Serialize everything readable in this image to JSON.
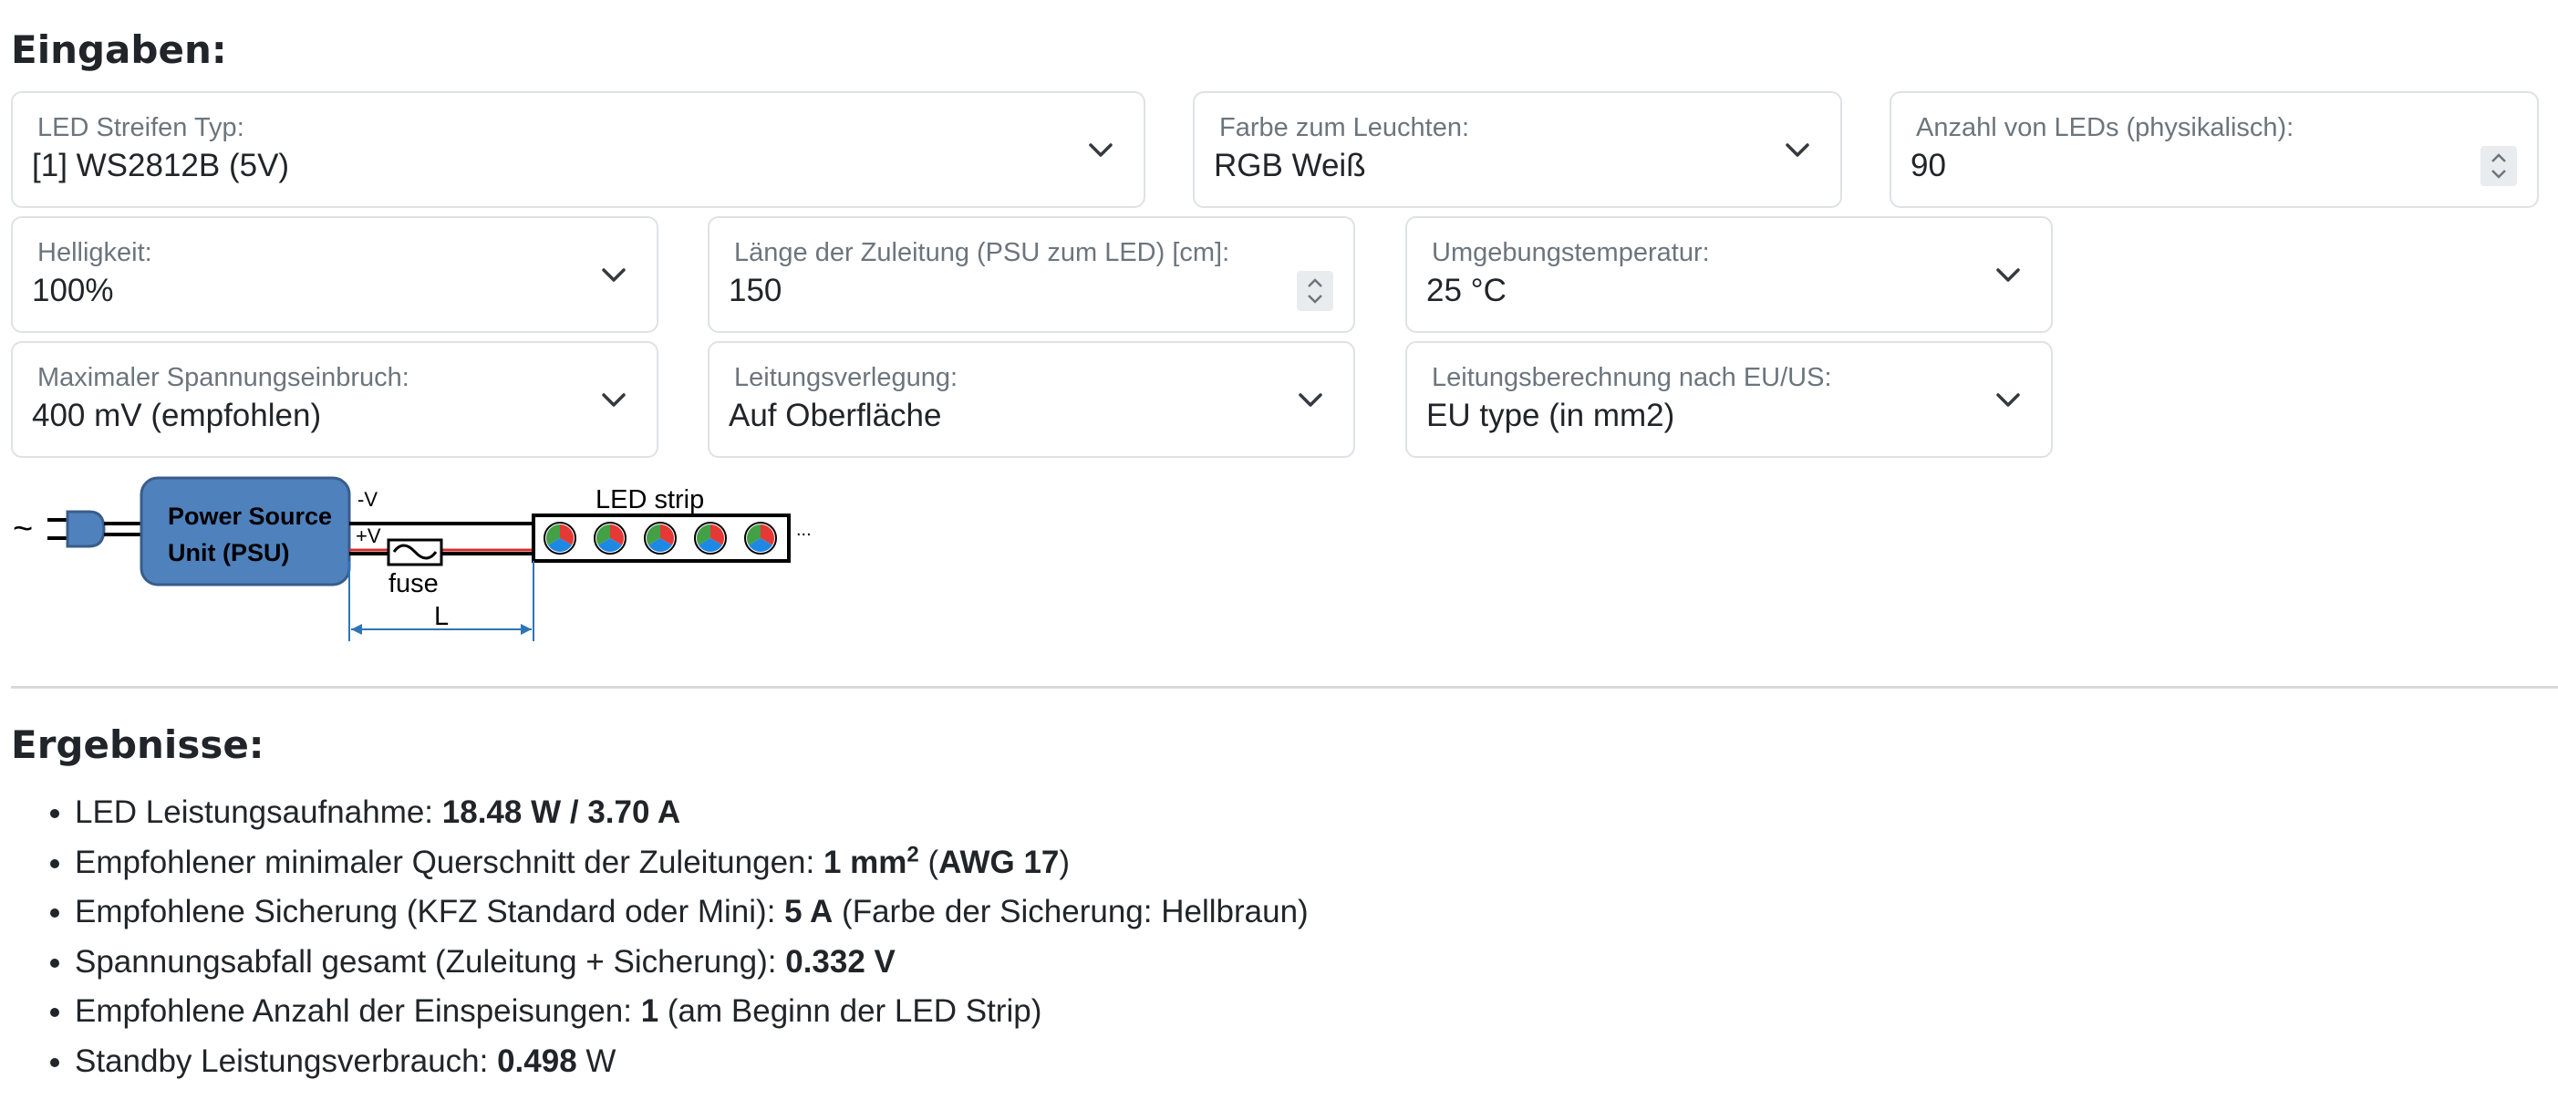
{
  "inputs": {
    "heading": "Eingaben:",
    "led_type": {
      "label": "LED Streifen Typ:",
      "value": "[1] WS2812B (5V)"
    },
    "color": {
      "label": "Farbe zum Leuchten:",
      "value": "RGB Weiß"
    },
    "led_count": {
      "label": "Anzahl von LEDs (physikalisch):",
      "value": "90"
    },
    "brightness": {
      "label": "Helligkeit:",
      "value": "100%"
    },
    "lead_length": {
      "label": "Länge der Zuleitung (PSU zum LED) [cm]:",
      "value": "150"
    },
    "ambient_temp": {
      "label": "Umgebungstemperatur:",
      "value": "25 °C"
    },
    "max_voltage_drop": {
      "label": "Maximaler Spannungseinbruch:",
      "value": "400 mV (empfohlen)"
    },
    "wiring": {
      "label": "Leitungsverlegung:",
      "value": "Auf Oberfläche"
    },
    "cable_standard": {
      "label": "Leitungsberechnung nach EU/US:",
      "value": "EU type (in mm2)"
    }
  },
  "diagram": {
    "ac_symbol": "~",
    "psu_line1": "Power Source",
    "psu_line2": "Unit (PSU)",
    "minus_v": "-V",
    "plus_v": "+V",
    "fuse_label": "fuse",
    "strip_label": "LED strip",
    "length_label": "L",
    "ellipsis": "..."
  },
  "results": {
    "heading": "Ergebnisse:",
    "power": {
      "label": "LED Leistungsaufnahme: ",
      "watts": "18.48 W",
      "sep": " / ",
      "amps": "3.70 A"
    },
    "cross_section": {
      "label": "Empfohlener minimaler Querschnitt der Zuleitungen: ",
      "value": "1 mm",
      "sup": "2",
      "open": " (",
      "awg": "AWG 17",
      "close": ")"
    },
    "fuse": {
      "label": "Empfohlene Sicherung (KFZ Standard oder Mini): ",
      "value": "5 A",
      "note": " (Farbe der Sicherung: Hellbraun)"
    },
    "voltage_drop": {
      "label": "Spannungsabfall gesamt (Zuleitung + Sicherung): ",
      "value": "0.332 V"
    },
    "feed_points": {
      "label": "Empfohlene Anzahl der Einspeisungen: ",
      "value": "1",
      "note": " (am Beginn der LED Strip)"
    },
    "standby": {
      "label": "Standby Leistungsverbrauch: ",
      "value": "0.498",
      "unit": " W"
    }
  },
  "colors": {
    "psu_fill": "#4f81bd",
    "psu_stroke": "#385d8a",
    "plus_wire": "#d32f2f",
    "dimension_line": "#2e75b6",
    "led_red": "#e53935",
    "led_green": "#43a047",
    "led_blue": "#1e88e5"
  },
  "icons": {
    "select": "chevron-down-icon",
    "number": "spinner-icon",
    "plug": "plug-icon",
    "fuse": "fuse-icon"
  }
}
